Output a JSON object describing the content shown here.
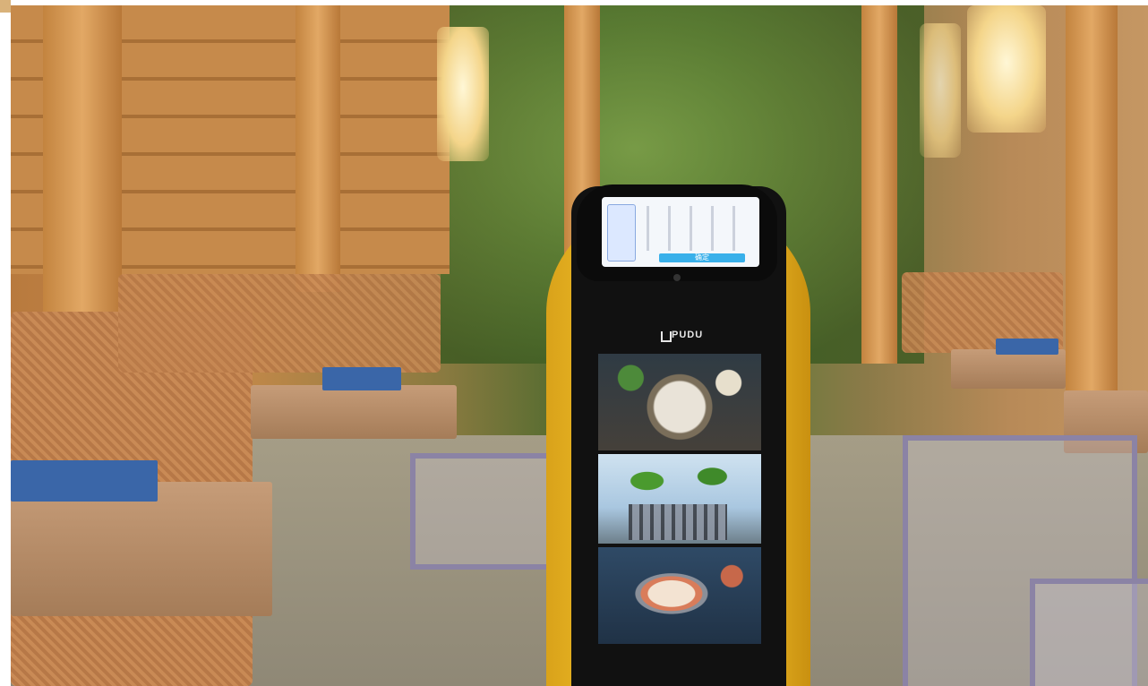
{
  "scene": {
    "robot": {
      "brand_text": "PUDU",
      "tablet_button_label": "确定",
      "display_panels": [
        "hotpot-dishes",
        "restaurant-exterior",
        "soup-dish"
      ]
    }
  },
  "colors": {
    "robot_yellow": "#f2c22a",
    "robot_black": "#111111",
    "wood": "#c68a4b",
    "foliage": "#5b7d33",
    "tablet_button": "#39b0ea"
  }
}
